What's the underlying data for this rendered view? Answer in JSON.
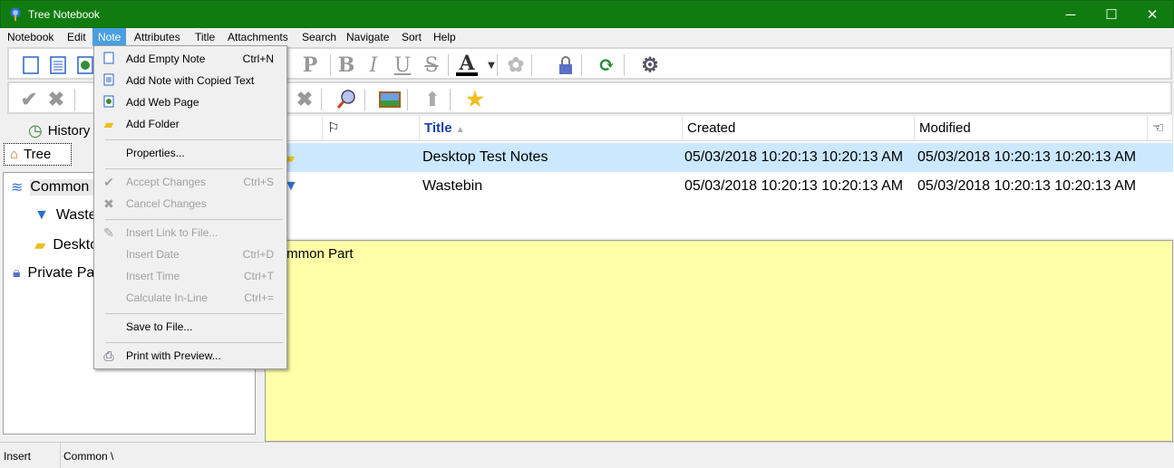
{
  "window": {
    "title": "Tree Notebook",
    "controls": {
      "minimize": "─",
      "maximize": "☐",
      "close": "✕"
    }
  },
  "menubar": [
    "Notebook",
    "Edit",
    "Note",
    "Attributes",
    "Title",
    "Attachments",
    "Search",
    "Navigate",
    "Sort",
    "Help"
  ],
  "active_menu": "Note",
  "toolbar1": {
    "icons": [
      "add-empty-note-icon",
      "add-note-copied-text-icon",
      "add-web-page-icon",
      "paragraph-icon",
      "bold-icon",
      "italic-icon",
      "underline-icon",
      "strikethrough-icon",
      "font-color-icon",
      "flower-icon",
      "lock-icon",
      "refresh-icon",
      "settings-gear-icon"
    ],
    "glyphs": {
      "p": "P",
      "b": "B",
      "i": "I",
      "u": "U",
      "s": "S",
      "a": "A"
    },
    "font_color": "#000000"
  },
  "toolbar2": {
    "icons": [
      "accept-check-icon",
      "cancel-x-icon",
      "delete-x-icon",
      "search-magnifier-icon",
      "image-icon",
      "up-arrow-icon",
      "star-icon"
    ]
  },
  "left_panel": {
    "tabs": {
      "history": "History",
      "tree": "Tree"
    },
    "tree": [
      {
        "label": "Common Part",
        "icon": "layers-icon",
        "selected": true
      },
      {
        "label": "Wastebin",
        "icon": "wastebin-icon"
      },
      {
        "label": "Desktop Test Notes",
        "icon": "folder-icon"
      },
      {
        "label": "Private Part",
        "icon": "lock-icon"
      }
    ]
  },
  "list": {
    "columns": [
      "",
      "",
      "Title",
      "Created",
      "Modified"
    ],
    "sort": {
      "column": "Title",
      "direction": "ascending"
    },
    "rows": [
      {
        "title": "Desktop Test Notes",
        "created": "05/03/2018 10:20:13 10:20:13 AM",
        "modified": "05/03/2018 10:20:13 10:20:13 AM",
        "selected": true,
        "icon": "folder-icon"
      },
      {
        "title": "Wastebin",
        "created": "05/03/2018 10:20:13 10:20:13 AM",
        "modified": "05/03/2018 10:20:13 10:20:13 AM",
        "selected": false,
        "icon": "wastebin-icon"
      }
    ]
  },
  "note": {
    "text": "Common Part",
    "background": "#ffffa8"
  },
  "status": {
    "mode": "Insert",
    "path": "Common \\"
  },
  "note_menu": {
    "items": [
      {
        "label": "Add Empty Note",
        "shortcut": "Ctrl+N",
        "enabled": true,
        "icon": "empty-note-icon"
      },
      {
        "label": "Add Note with Copied Text",
        "shortcut": "",
        "enabled": true,
        "icon": "text-note-icon"
      },
      {
        "label": "Add Web Page",
        "shortcut": "",
        "enabled": true,
        "icon": "web-page-icon"
      },
      {
        "label": "Add Folder",
        "shortcut": "",
        "enabled": true,
        "icon": "folder-icon"
      },
      {
        "label": "Properties...",
        "shortcut": "",
        "enabled": true
      },
      {
        "label": "Accept Changes",
        "shortcut": "Ctrl+S",
        "enabled": false,
        "icon": "check-icon"
      },
      {
        "label": "Cancel Changes",
        "shortcut": "",
        "enabled": false,
        "icon": "x-icon"
      },
      {
        "label": "Insert Link to File...",
        "shortcut": "",
        "enabled": false,
        "icon": "link-icon"
      },
      {
        "label": "Insert Date",
        "shortcut": "Ctrl+D",
        "enabled": false
      },
      {
        "label": "Insert Time",
        "shortcut": "Ctrl+T",
        "enabled": false
      },
      {
        "label": "Calculate In-Line",
        "shortcut": "Ctrl+=",
        "enabled": false
      },
      {
        "label": "Save to File...",
        "shortcut": "",
        "enabled": true
      },
      {
        "label": "Print with Preview...",
        "shortcut": "",
        "enabled": true,
        "icon": "printer-icon"
      }
    ]
  },
  "colors": {
    "titlebar": "#107c10",
    "menu_highlight": "#4a9fe0",
    "selection": "#cce8ff",
    "title_column": "#1a3fb0"
  }
}
